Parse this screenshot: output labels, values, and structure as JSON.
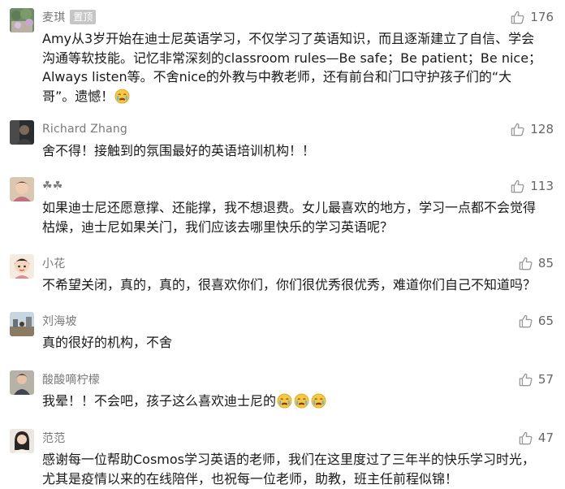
{
  "comments": [
    {
      "name": "麦琪",
      "badge": "置顶",
      "likes": "176",
      "lines": [
        "Amy从3岁开始在迪士尼英语学习，不仅学习了英语知识，而且逐渐建立了自信、学会",
        "沟通等软技能。记忆非常深刻的classroom rules—Be safe；Be patient；Be nice；",
        "Always listen等。不舍nice的外教与中教老师，还有前台和门口守护孩子们的“大",
        "哥”。遗憾！"
      ],
      "avatar_icon": "ivy-wall-avatar",
      "emoji_icons": [
        "crying-face-emoji"
      ]
    },
    {
      "name": "Richard Zhang",
      "likes": "128",
      "lines": [
        "舍不得！接触到的氛围最好的英语培训机构！！"
      ],
      "avatar_icon": "dark-portrait-avatar"
    },
    {
      "name": "☘☘",
      "likes": "113",
      "lines": [
        "如果迪士尼还愿意撑、还能撑，我不想退费。女儿最喜欢的地方，学习一点都不会觉得",
        "枯燥，迪士尼如果关门，我们应该去哪里快乐的学习英语呢？"
      ],
      "avatar_icon": "child-portrait-avatar"
    },
    {
      "name": "小花",
      "likes": "85",
      "lines": [
        "不希望关闭，真的，真的，很喜欢你们，你们很优秀很优秀，难道你们自己不知道吗？"
      ],
      "avatar_icon": "cartoon-child-avatar"
    },
    {
      "name": "刘海坡",
      "likes": "65",
      "lines": [
        "真的很好的机构，不舍"
      ],
      "avatar_icon": "outdoor-photo-avatar"
    },
    {
      "name": "酸酸嘀柠檬",
      "likes": "57",
      "lines": [
        "我晕！！不会吧，孩子这么喜欢迪士尼的"
      ],
      "avatar_icon": "person-photo-avatar",
      "emoji_icons": [
        "crying-face-emoji",
        "crying-face-emoji",
        "crying-face-emoji"
      ]
    },
    {
      "name": "范范",
      "likes": "47",
      "lines": [
        "感谢每一位帮助Cosmos学习英语的老师，我们在这里度过了三年半的快乐学习时光，",
        "尤其是疫情以来的在线陪伴，也祝每一位老师，助教，班主任前程似锦！"
      ],
      "avatar_icon": "woman-portrait-avatar"
    }
  ],
  "like_icon": "thumbs-up-icon",
  "colors": {
    "name": "#7a7a7a",
    "text": "#191919",
    "like": "#666666",
    "badge_bg": "#c6c6c6"
  }
}
